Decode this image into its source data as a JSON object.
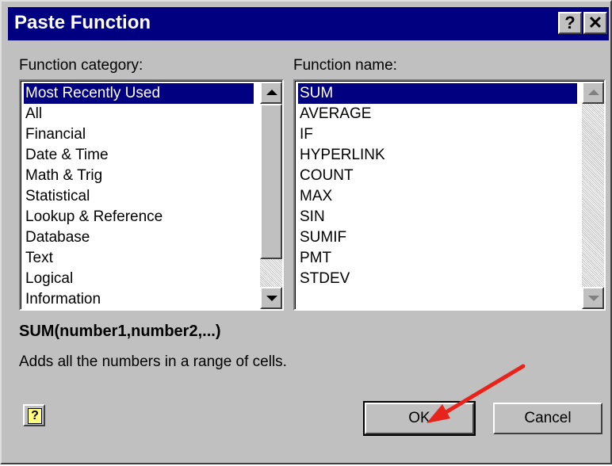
{
  "window": {
    "title": "Paste Function",
    "help_glyph": "?",
    "close_glyph": "✕"
  },
  "category": {
    "label": "Function category:",
    "items": [
      "Most Recently Used",
      "All",
      "Financial",
      "Date & Time",
      "Math & Trig",
      "Statistical",
      "Lookup & Reference",
      "Database",
      "Text",
      "Logical",
      "Information"
    ],
    "selected": "Most Recently Used"
  },
  "function_list": {
    "label": "Function name:",
    "items": [
      "SUM",
      "AVERAGE",
      "IF",
      "HYPERLINK",
      "COUNT",
      "MAX",
      "SIN",
      "SUMIF",
      "PMT",
      "STDEV"
    ],
    "selected": "SUM"
  },
  "syntax": "SUM(number1,number2,...)",
  "description": "Adds all the numbers in a range of cells.",
  "buttons": {
    "ok": "OK",
    "cancel": "Cancel",
    "help_icon": "?"
  },
  "colors": {
    "titlebar": "#000080",
    "selection": "#000080",
    "dialog_face": "#c0c0c0",
    "annotation_arrow": "#e8231b"
  },
  "icons": [
    "help-icon",
    "close-icon",
    "scroll-up-icon",
    "scroll-down-icon",
    "office-assistant-icon",
    "annotation-arrow-icon"
  ]
}
